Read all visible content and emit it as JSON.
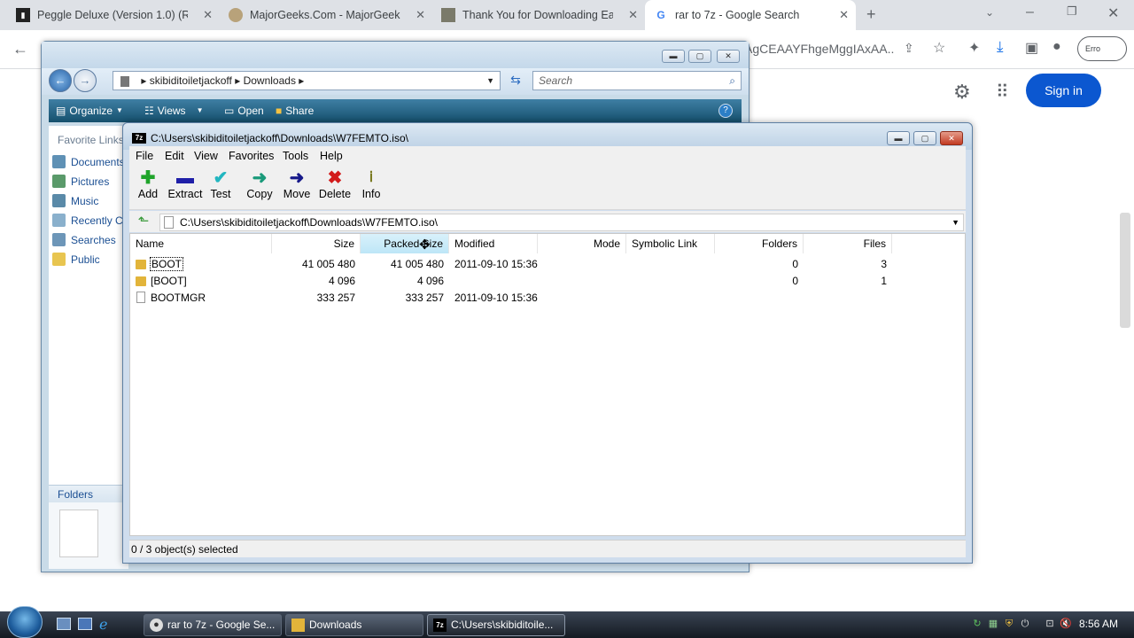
{
  "chrome": {
    "tabs": [
      {
        "title": "Peggle Deluxe (Version 1.0) (Rev",
        "icon": "peggle-favicon"
      },
      {
        "title": "MajorGeeks.Com - MajorGeeks",
        "icon": "majorgeeks-favicon"
      },
      {
        "title": "Thank You for Downloading Eas",
        "icon": "download-favicon"
      },
      {
        "title": "rar to 7z - Google Search",
        "icon": "google-favicon",
        "active": true
      }
    ],
    "new_tab": "+",
    "omnibox_text": "AgCEAAYFhgeMggIAxAA...",
    "sign_in": "Sign in",
    "profile_label": "Erro"
  },
  "explorer": {
    "breadcrumb": [
      "skibiditoiletjackoff",
      "Downloads"
    ],
    "search_placeholder": "Search",
    "toolbar": {
      "organize": "Organize",
      "views": "Views",
      "open": "Open",
      "share": "Share"
    },
    "favorite_links_heading": "Favorite Links",
    "favorite_links": [
      "Documents",
      "Pictures",
      "Music",
      "Recently Changed",
      "Searches",
      "Public"
    ],
    "folders_label": "Folders"
  },
  "zip": {
    "title": "C:\\Users\\skibiditoiletjackoff\\Downloads\\W7FEMTO.iso\\",
    "menu": [
      "File",
      "Edit",
      "View",
      "Favorites",
      "Tools",
      "Help"
    ],
    "toolbar": [
      "Add",
      "Extract",
      "Test",
      "Copy",
      "Move",
      "Delete",
      "Info"
    ],
    "path": "C:\\Users\\skibiditoiletjackoff\\Downloads\\W7FEMTO.iso\\",
    "columns": [
      "Name",
      "Size",
      "Packed Size",
      "Modified",
      "Mode",
      "Symbolic Link",
      "Folders",
      "Files"
    ],
    "rows": [
      {
        "name": "BOOT",
        "size": "41 005 480",
        "packed": "41 005 480",
        "modified": "2011-09-10 15:36",
        "folders": "0",
        "files": "3",
        "type": "folder"
      },
      {
        "name": "[BOOT]",
        "size": "4 096",
        "packed": "4 096",
        "modified": "",
        "folders": "0",
        "files": "1",
        "type": "folder"
      },
      {
        "name": "BOOTMGR",
        "size": "333 257",
        "packed": "333 257",
        "modified": "2011-09-10 15:36",
        "folders": "",
        "files": "",
        "type": "file"
      }
    ],
    "status": "0 / 3 object(s) selected"
  },
  "taskbar": {
    "tasks": [
      {
        "label": "rar to 7z - Google Se...",
        "icon": "chrome-icon"
      },
      {
        "label": "Downloads",
        "icon": "folder-icon"
      },
      {
        "label": "C:\\Users\\skibiditoile...",
        "icon": "7zip-icon",
        "active": true
      }
    ],
    "clock": "8:56 AM"
  },
  "colors": {
    "chrome_signin": "#0b57d0",
    "zip_title": "#bcd1e5",
    "explorer_cmdbar": "#15506d",
    "taskbar": "#1c232d"
  }
}
